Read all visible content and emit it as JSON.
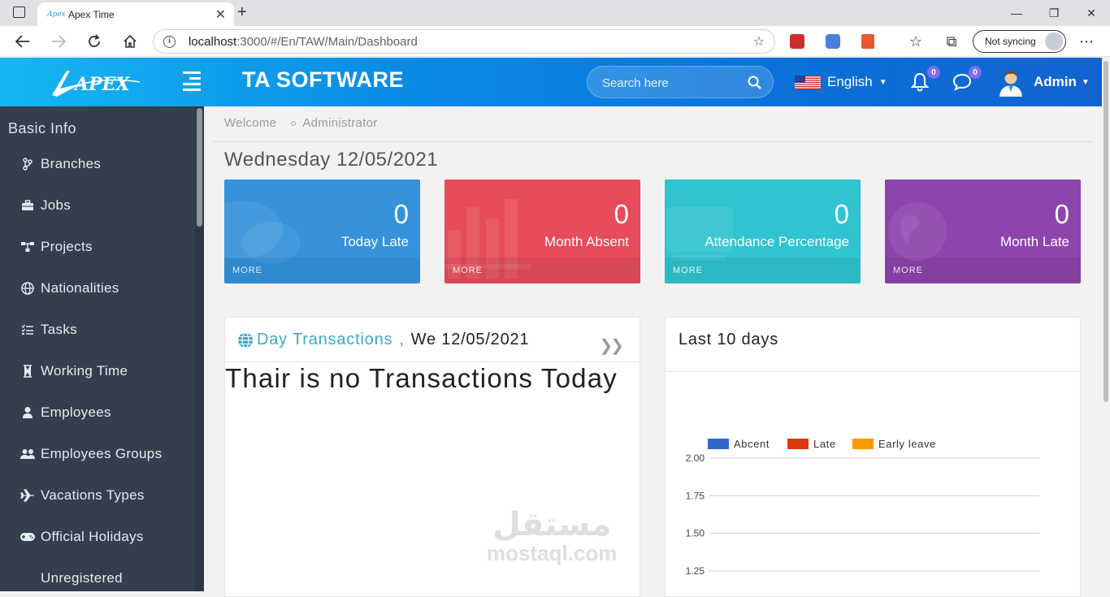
{
  "browser": {
    "tab_title": "Apex Time",
    "favicon_text": "Apex",
    "url_host": "localhost",
    "url_rest": ":3000/#/En/TAW/Main/Dashboard",
    "sync_label": "Not syncing"
  },
  "header": {
    "logo_text": "APEX",
    "brand": "TA SOFTWARE",
    "search_placeholder": "Search here",
    "language": "English",
    "notifications_count": "0",
    "messages_count": "0",
    "user_name": "Admin"
  },
  "sidebar": {
    "section_title": "Basic Info",
    "items": [
      {
        "label": "Branches",
        "icon": "branch-icon"
      },
      {
        "label": "Jobs",
        "icon": "briefcase-icon"
      },
      {
        "label": "Projects",
        "icon": "sitemap-icon"
      },
      {
        "label": "Nationalities",
        "icon": "globe-icon"
      },
      {
        "label": "Tasks",
        "icon": "tasks-icon"
      },
      {
        "label": "Working Time",
        "icon": "hourglass-icon"
      },
      {
        "label": "Employees",
        "icon": "user-icon"
      },
      {
        "label": "Employees Groups",
        "icon": "users-icon"
      },
      {
        "label": "Vacations Types",
        "icon": "plane-icon"
      },
      {
        "label": "Official Holidays",
        "icon": "gamepad-icon"
      },
      {
        "label": "Unregistered",
        "icon": ""
      }
    ]
  },
  "breadcrumb": {
    "items": [
      "Welcome",
      "Administrator"
    ]
  },
  "date_heading": "Wednesday 12/05/2021",
  "stats": [
    {
      "value": "0",
      "label": "Today Late",
      "more": "MORE",
      "color": "#3592db"
    },
    {
      "value": "0",
      "label": "Month Absent",
      "more": "MORE",
      "color": "#e64c5a"
    },
    {
      "value": "0",
      "label": "Attendance Percentage",
      "more": "MORE",
      "color": "#2fc4cf"
    },
    {
      "value": "0",
      "label": "Month Late",
      "more": "MORE",
      "color": "#8e44ad"
    }
  ],
  "transactions": {
    "title": "Day Transactions",
    "separator": ",",
    "date": "We 12/05/2021",
    "empty_message": "Thair is no Transactions Today",
    "watermark_ar": "مستقل",
    "watermark_en": "mostaql.com"
  },
  "chart_data": {
    "type": "bar",
    "title": "Last 10 days",
    "series": [
      {
        "name": "Abcent",
        "color": "#3366cc",
        "values": []
      },
      {
        "name": "Late",
        "color": "#dc3912",
        "values": []
      },
      {
        "name": "Early leave",
        "color": "#ff9900",
        "values": []
      }
    ],
    "y_ticks": [
      "2.00",
      "1.75",
      "1.50",
      "1.25"
    ],
    "ylim_visible": [
      1.25,
      2.0
    ],
    "legend_position": "top",
    "grid": true
  }
}
